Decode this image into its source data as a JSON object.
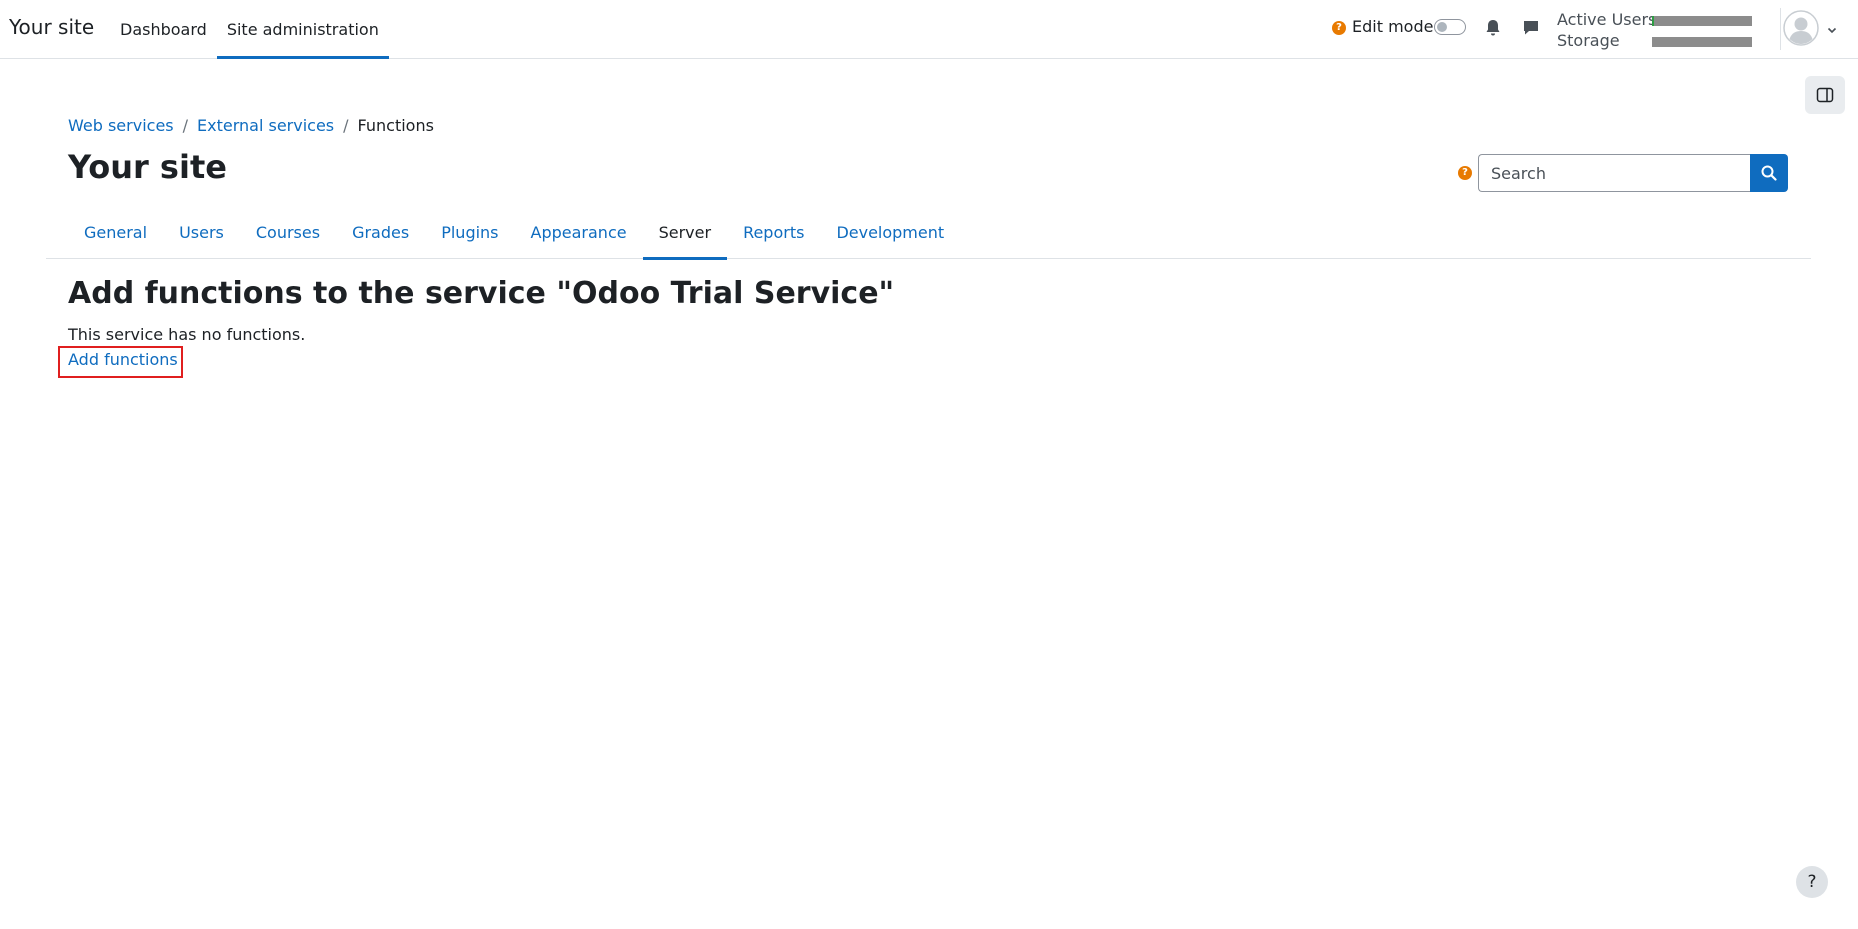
{
  "navbar": {
    "brand": "Your site",
    "primary_nav": [
      {
        "label": "Dashboard",
        "active": false
      },
      {
        "label": "Site administration",
        "active": true
      }
    ],
    "edit_mode_label": "Edit mode",
    "edit_mode_on": false,
    "usage": {
      "active_users_label": "Active Users",
      "active_users_fraction": 0.02,
      "storage_label": "Storage",
      "storage_fraction": 0.0
    },
    "icons": {
      "help": "question-circle-icon",
      "notifications": "bell-icon",
      "messages": "chat-bubble-icon",
      "avatar": "user-avatar-icon",
      "menu": "chevron-down-icon",
      "drawer": "sidebar-toggle-icon",
      "search": "search-icon"
    },
    "help_glyph": "?"
  },
  "colors": {
    "accent": "#0f6cbf",
    "help_badge": "#e87a00",
    "usage_bar": "#8c8c8c",
    "usage_fill": "#2e9e44",
    "highlight": "#e01f1f"
  },
  "header": {
    "breadcrumb": [
      {
        "label": "Web services",
        "link": true
      },
      {
        "label": "External services",
        "link": true
      },
      {
        "label": "Functions",
        "link": false
      }
    ],
    "breadcrumb_separator": "/",
    "title": "Your site",
    "search_placeholder": "Search"
  },
  "secondary_nav": [
    {
      "label": "General",
      "active": false
    },
    {
      "label": "Users",
      "active": false
    },
    {
      "label": "Courses",
      "active": false
    },
    {
      "label": "Grades",
      "active": false
    },
    {
      "label": "Plugins",
      "active": false
    },
    {
      "label": "Appearance",
      "active": false
    },
    {
      "label": "Server",
      "active": true
    },
    {
      "label": "Reports",
      "active": false
    },
    {
      "label": "Development",
      "active": false
    }
  ],
  "main": {
    "heading": "Add functions to the service \"Odoo Trial Service\"",
    "empty_message": "This service has no functions.",
    "add_link_label": "Add functions"
  },
  "footer": {
    "help_glyph": "?"
  }
}
